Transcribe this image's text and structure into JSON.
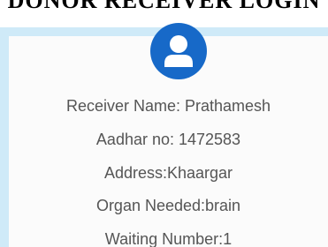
{
  "heading": "DONOR RECEIVER LOGIN",
  "avatar_icon": "user-icon",
  "colors": {
    "panel_background": "#cfeaf8",
    "card_background": "#fbfbfb",
    "avatar_background": "#1769c8",
    "text": "#555555"
  },
  "receiver": {
    "name_line": "Receiver Name: Prathamesh",
    "aadhar_line": "Aadhar no: 1472583",
    "address_line": "Address:Khaargar",
    "organ_line": "Organ Needed:brain",
    "waiting_line": "Waiting Number:1"
  }
}
